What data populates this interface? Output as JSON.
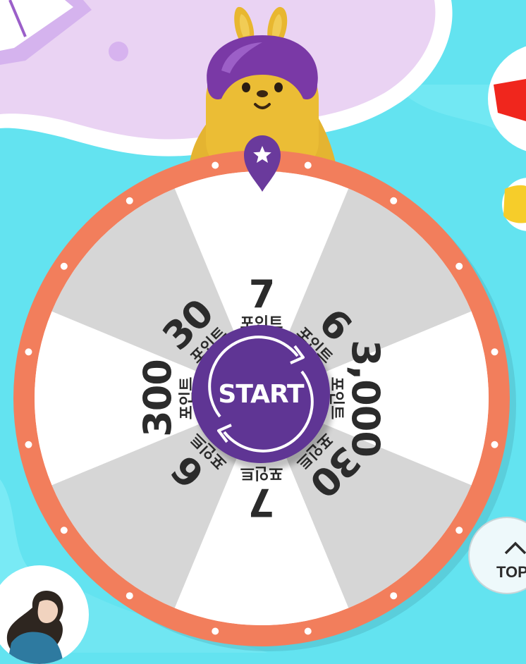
{
  "wheel": {
    "segments": [
      {
        "value": "7",
        "unit": "포인트",
        "shade": "light"
      },
      {
        "value": "6",
        "unit": "포인트",
        "shade": "gray"
      },
      {
        "value": "3,000",
        "unit": "포인트",
        "shade": "light"
      },
      {
        "value": "30",
        "unit": "포인트",
        "shade": "gray"
      },
      {
        "value": "7",
        "unit": "포인트",
        "shade": "light"
      },
      {
        "value": "6",
        "unit": "포인트",
        "shade": "gray"
      },
      {
        "value": "300",
        "unit": "포인트",
        "shade": "light"
      },
      {
        "value": "30",
        "unit": "포인트",
        "shade": "gray"
      }
    ],
    "start_label": "START"
  },
  "top_button": {
    "label": "TOP"
  },
  "colors": {
    "background": "#63e3f0",
    "blob": "#ead3f3",
    "rim": "#f27e5c",
    "segment_light": "#ffffff",
    "segment_gray": "#d6d6d6",
    "start": "#5f3594",
    "pointer": "#6a3a9c",
    "mascot_body": "#e4b431",
    "mascot_helmet": "#7a39a6"
  },
  "icons": [
    "star-icon",
    "refresh-arrows-icon",
    "chevron-up-icon"
  ]
}
